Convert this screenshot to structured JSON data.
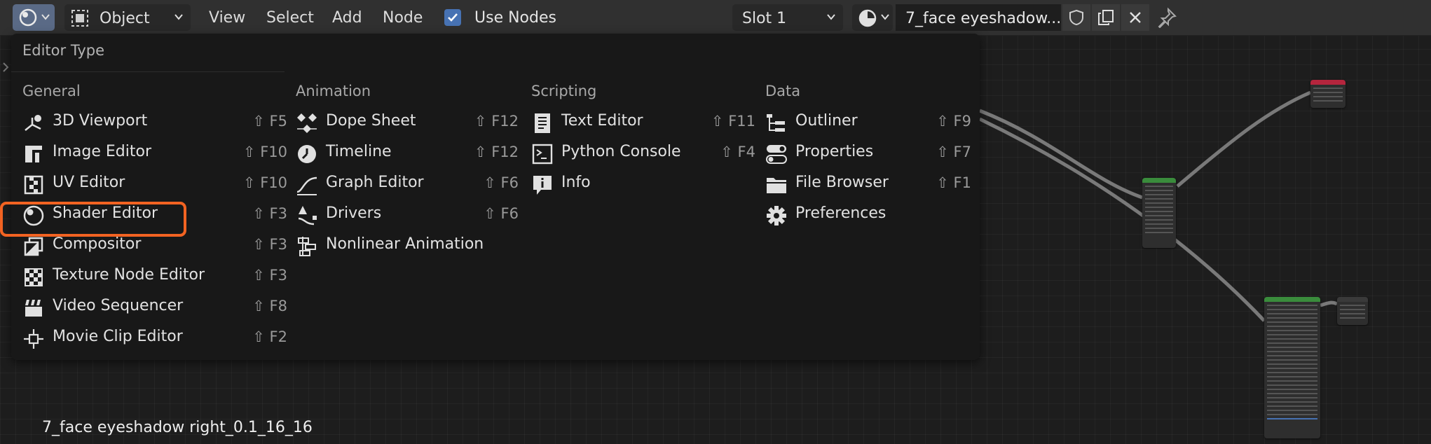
{
  "header": {
    "editor_type_icon": "shader-editor-icon",
    "mode": "Object",
    "menus": [
      "View",
      "Select",
      "Add",
      "Node"
    ],
    "use_nodes_label": "Use Nodes",
    "use_nodes_checked": true,
    "slot": "Slot 1",
    "material_name": "7_face eyeshadow...",
    "colors": {
      "header_bg": "#303030",
      "accent": "#4772b3",
      "highlight": "#f26322"
    }
  },
  "popup": {
    "title": "Editor Type",
    "columns": [
      {
        "heading": "General",
        "items": [
          {
            "label": "3D Viewport",
            "shortcut": "⇧ F5",
            "icon": "3d-viewport-icon"
          },
          {
            "label": "Image Editor",
            "shortcut": "⇧ F10",
            "icon": "image-editor-icon"
          },
          {
            "label": "UV Editor",
            "shortcut": "⇧ F10",
            "icon": "uv-editor-icon"
          },
          {
            "label": "Shader Editor",
            "shortcut": "⇧ F3",
            "icon": "shader-editor-icon"
          },
          {
            "label": "Compositor",
            "shortcut": "⇧ F3",
            "icon": "compositor-icon"
          },
          {
            "label": "Texture Node Editor",
            "shortcut": "⇧ F3",
            "icon": "texture-node-icon"
          },
          {
            "label": "Video Sequencer",
            "shortcut": "⇧ F8",
            "icon": "video-sequencer-icon"
          },
          {
            "label": "Movie Clip Editor",
            "shortcut": "⇧ F2",
            "icon": "movie-clip-icon"
          }
        ]
      },
      {
        "heading": "Animation",
        "items": [
          {
            "label": "Dope Sheet",
            "shortcut": "⇧ F12",
            "icon": "dope-sheet-icon"
          },
          {
            "label": "Timeline",
            "shortcut": "⇧ F12",
            "icon": "timeline-icon"
          },
          {
            "label": "Graph Editor",
            "shortcut": "⇧ F6",
            "icon": "graph-editor-icon"
          },
          {
            "label": "Drivers",
            "shortcut": "⇧ F6",
            "icon": "drivers-icon"
          },
          {
            "label": "Nonlinear Animation",
            "shortcut": "",
            "icon": "nla-icon"
          }
        ]
      },
      {
        "heading": "Scripting",
        "items": [
          {
            "label": "Text Editor",
            "shortcut": "⇧ F11",
            "icon": "text-editor-icon"
          },
          {
            "label": "Python Console",
            "shortcut": "⇧ F4",
            "icon": "console-icon"
          },
          {
            "label": "Info",
            "shortcut": "",
            "icon": "info-icon"
          }
        ]
      },
      {
        "heading": "Data",
        "items": [
          {
            "label": "Outliner",
            "shortcut": "⇧ F9",
            "icon": "outliner-icon"
          },
          {
            "label": "Properties",
            "shortcut": "⇧ F7",
            "icon": "properties-icon"
          },
          {
            "label": "File Browser",
            "shortcut": "⇧ F1",
            "icon": "file-browser-icon"
          },
          {
            "label": "Preferences",
            "shortcut": "",
            "icon": "preferences-icon"
          }
        ]
      }
    ]
  },
  "canvas": {
    "node_tree_name": "7_face eyeshadow right_0.1_16_16"
  }
}
